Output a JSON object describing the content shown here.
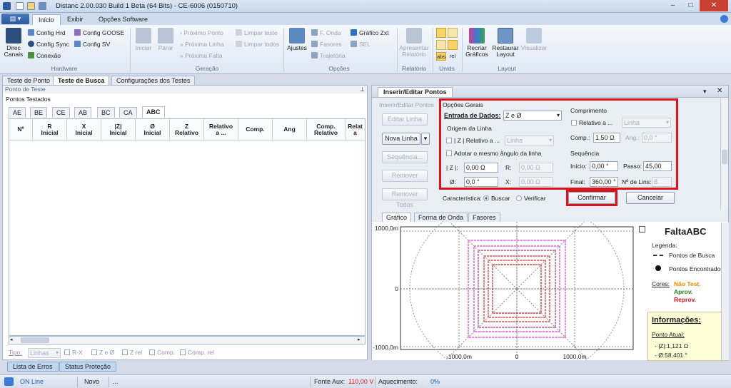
{
  "window": {
    "title": "Distanc 2.00.030 Build 1 Beta (64 Bits) - CE-6006 (0150710)"
  },
  "ribbon_tabs": [
    "Início",
    "Exibir",
    "Opções Software"
  ],
  "ribbon": {
    "hardware": {
      "label": "Hardware",
      "direc": "Direc\nCanais",
      "config_hrd": "Config Hrd",
      "config_sync": "Config Sync",
      "conexao": "Conexão",
      "config_goose": "Config GOOSE",
      "config_sv": "Config SV"
    },
    "geracao": {
      "label": "Geração",
      "iniciar": "Iniciar",
      "parar": "Parar",
      "proximo_ponto": "Próximo Ponto",
      "proxima_linha": "Próxima Linha",
      "proxima_falta": "Próxima Falta",
      "limpar_teste": "Limpar teste",
      "limpar_todos": "Limpar todos"
    },
    "opcoes": {
      "label": "Opções",
      "ajustes": "Ajustes",
      "f_onda": "F. Onda",
      "fasores": "Fasores",
      "trajetoria": "Trajetória",
      "grafico_zxt": "Gráfico Zxt",
      "sel": "SEL"
    },
    "relatorio": {
      "label": "Relatório",
      "apresentar": "Apresentar\nRelatório"
    },
    "unids": {
      "label": "Unids",
      "abs": "abs",
      "rel": "rel"
    },
    "layout": {
      "label": "Layout",
      "recriar": "Recriar\nGráficos",
      "restaurar": "Restaurar\nLayout",
      "visualizar": "Visualizar"
    }
  },
  "page_tabs": [
    "Teste de Ponto",
    "Teste de Busca",
    "Configurações dos Testes"
  ],
  "left": {
    "panel_title": "Ponto de Teste",
    "pontos_testados": "Pontos Testados",
    "fault_tabs": [
      "AE",
      "BE",
      "CE",
      "AB",
      "BC",
      "CA",
      "ABC"
    ],
    "columns": [
      "Nº",
      "R\nInicial",
      "X\nInicial",
      "|Z|\nInicial",
      "Ø\nInicial",
      "Z\nRelativo",
      "Relativo\na ...",
      "Comp.",
      "Ang",
      "Comp.\nRelativo",
      "Relat\na"
    ],
    "tipo_label": "Tipo:",
    "tipo_value": "Linhas",
    "checks": [
      "R-X",
      "Z e Ø",
      "Z rel",
      "Comp.",
      "Comp. rel"
    ]
  },
  "bottom_tabs": [
    "Lista de Erros",
    "Status Proteção"
  ],
  "status": {
    "online": "ON Line",
    "novo": "Novo",
    "ellipsis": "...",
    "fonte_label": "Fonte Aux:",
    "fonte_value": "110,00 V",
    "aquec_label": "Aquecimento:",
    "aquec_value": "0%"
  },
  "insert": {
    "header": "Inserir/Editar Pontos",
    "sub": "Inserir/Editar Pontos",
    "editar_linha": "Editar Linha",
    "nova_linha": "Nova Linha",
    "sequencia": "Sequência...",
    "remover": "Remover",
    "remover_todos": "Remover Todos",
    "opcoes_gerais": "Opções Gerais",
    "entrada_label": "Entrada de Dados:",
    "entrada_value": "Z e Ø",
    "origem": "Origem da Linha",
    "z_relativo": "| Z | Relativo a ...",
    "z_rel_value": "Linha",
    "adotar": "Adotar o mesmo ângulo da linha",
    "z_label": "| Z |:",
    "z_value": "0,00 Ω",
    "r_label": "R:",
    "r_value": "0,00 Ω",
    "phi_label": "Ø:",
    "phi_value": "0,0 °",
    "x_label": "X:",
    "x_value": "0,00 Ω",
    "comprimento": "Comprimento",
    "rel_a": "Relativo a ...",
    "rel_a_value": "Linha",
    "comp_label": "Comp.:",
    "comp_value": "1,50 Ω",
    "ang_label": "Ang.:",
    "ang_value": "0,0 °",
    "sequencia_title": "Sequência",
    "inicio_label": "Início:",
    "inicio_value": "0,00 °",
    "passo_label": "Passo:",
    "passo_value": "45,00",
    "final_label": "Final:",
    "final_value": "360,00 °",
    "nlins_label": "Nº de Lins:",
    "nlins_value": "8",
    "caracteristica": "Característica:",
    "buscar": "Buscar",
    "verificar": "Verificar",
    "confirmar": "Confirmar",
    "cancelar": "Cancelar"
  },
  "graph": {
    "tabs": [
      "Gráfico",
      "Forma de Onda",
      "Fasores"
    ],
    "title": "FaltaABC",
    "legenda": "Legenda:",
    "pontos_busca": "Pontos de Busca",
    "pontos_encontrados": "Pontos Encontrados",
    "cores": "Cores:",
    "nao_test": "Não Test.",
    "aprov": "Aprov.",
    "reprov": "Reprov.",
    "informacoes": "Informações:",
    "ponto_atual": "Ponto Atual:",
    "z_info": "- |Z|:1,121 Ω",
    "phi_info": "- Ø:58,401 °",
    "y_top": "1000,0m",
    "y_mid": "0",
    "y_bot": "-1000,0m",
    "x_left": "-1000,0m",
    "x_mid": "0",
    "x_right": "1000,0m",
    "colors": {
      "nao_test": "#f08c00",
      "aprov": "#1a8a1a",
      "reprov": "#d9141a"
    }
  }
}
